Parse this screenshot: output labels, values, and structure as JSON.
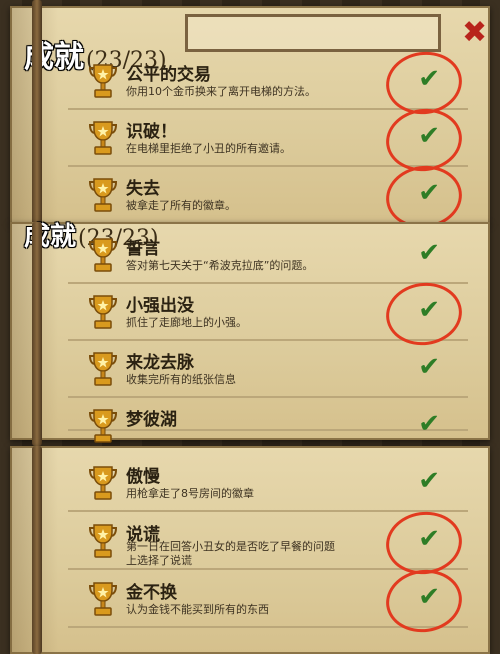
{
  "panel1": {
    "title": "成就",
    "count": "(23/23)",
    "close_label": "✖",
    "items": [
      {
        "name": "公平的交易",
        "desc": "你用10个金币换来了离开电梯的方法。",
        "circled": true
      },
      {
        "name": "识破！",
        "desc": "在电梯里拒绝了小丑的所有邀请。",
        "circled": true
      },
      {
        "name": "失去",
        "desc": "被拿走了所有的徽章。",
        "circled": true
      }
    ]
  },
  "panel2": {
    "title": "成就",
    "count": "(23/23)",
    "items": [
      {
        "name": "誓言",
        "desc": "答对第七天关于“希波克拉底”的问题。",
        "circled": false
      },
      {
        "name": "小强出没",
        "desc": "抓住了走廊地上的小强。",
        "circled": true
      },
      {
        "name": "来龙去脉",
        "desc": "收集完所有的纸张信息",
        "circled": false
      },
      {
        "name": "梦彼湖",
        "desc": "",
        "circled": false
      }
    ]
  },
  "panel3": {
    "items": [
      {
        "name": "傲慢",
        "desc": "用枪拿走了8号房间的徽章",
        "circled": false
      },
      {
        "name": "说谎",
        "desc": "第一日在回答小丑女的是否吃了早餐的问题上选择了说谎",
        "circled": true
      },
      {
        "name": "金不换",
        "desc": "认为金钱不能买到所有的东西",
        "circled": true
      }
    ]
  },
  "check_symbol": "✔",
  "colors": {
    "check": "#2e7d26",
    "circle": "#e23a1f",
    "trophy": "#d99a1e",
    "close": "#b8241c"
  }
}
